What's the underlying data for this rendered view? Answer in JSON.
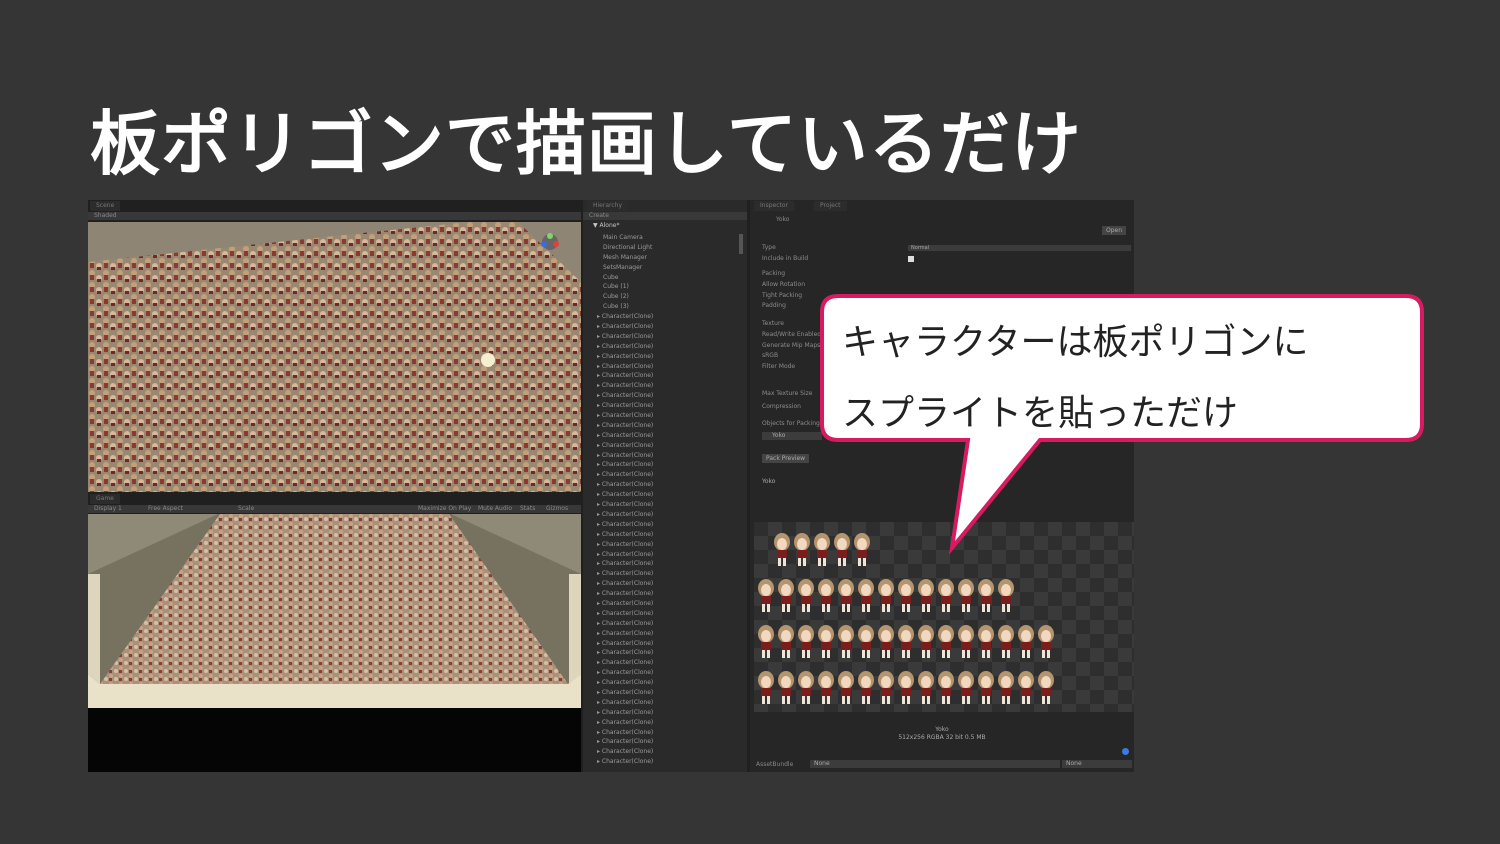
{
  "slide": {
    "title": "板ポリゴンで描画しているだけ"
  },
  "callout": {
    "line1": "キャラクターは板ポリゴンに",
    "line2": "スプライトを貼っただけ",
    "border_color": "#d81b60"
  },
  "editor": {
    "scene_tab": "Scene",
    "scene_shading": "Shaded",
    "game_tab": "Game",
    "game_display": "Display 1",
    "game_aspect": "Free Aspect",
    "game_scale": "Scale",
    "game_buttons": [
      "Maximize On Play",
      "Mute Audio",
      "Stats",
      "Gizmos"
    ],
    "hierarchy": {
      "tab": "Hierarchy",
      "create": "Create",
      "scene_name": "Alone*",
      "items": [
        "Main Camera",
        "Directional Light",
        "Mesh Manager",
        "SetsManager",
        "Cube",
        "Cube (1)",
        "Cube (2)",
        "Cube (3)"
      ],
      "clone_label": "Character(Clone)",
      "clone_count": 46
    },
    "inspector": {
      "tab": "Inspector",
      "project_tab": "Project",
      "asset_name": "Yoko",
      "open_button": "Open",
      "props": [
        {
          "label": "Type",
          "value": "Normal"
        },
        {
          "label": "Include in Build",
          "value": "checked"
        },
        {
          "label": "Packing",
          "value": ""
        },
        {
          "label": "Allow Rotation",
          "value": ""
        },
        {
          "label": "Tight Packing",
          "value": ""
        },
        {
          "label": "Padding",
          "value": ""
        },
        {
          "label": "Texture",
          "value": ""
        },
        {
          "label": "Read/Write Enabled",
          "value": ""
        },
        {
          "label": "Generate Mip Maps",
          "value": ""
        },
        {
          "label": "sRGB",
          "value": ""
        },
        {
          "label": "Filter Mode",
          "value": ""
        },
        {
          "label": "Max Texture Size",
          "value": ""
        },
        {
          "label": "Compression",
          "value": ""
        },
        {
          "label": "Objects for Packing",
          "value": ""
        }
      ],
      "object_field": "Yoko",
      "pack_button": "Pack Preview",
      "preview_title": "Yoko",
      "tex_name": "Yoko",
      "tex_info": "512x256 RGBA 32 bit   0.5 MB",
      "asset_bundle_label": "AssetBundle",
      "asset_bundle_value": "None",
      "asset_bundle_variant": "None"
    }
  }
}
